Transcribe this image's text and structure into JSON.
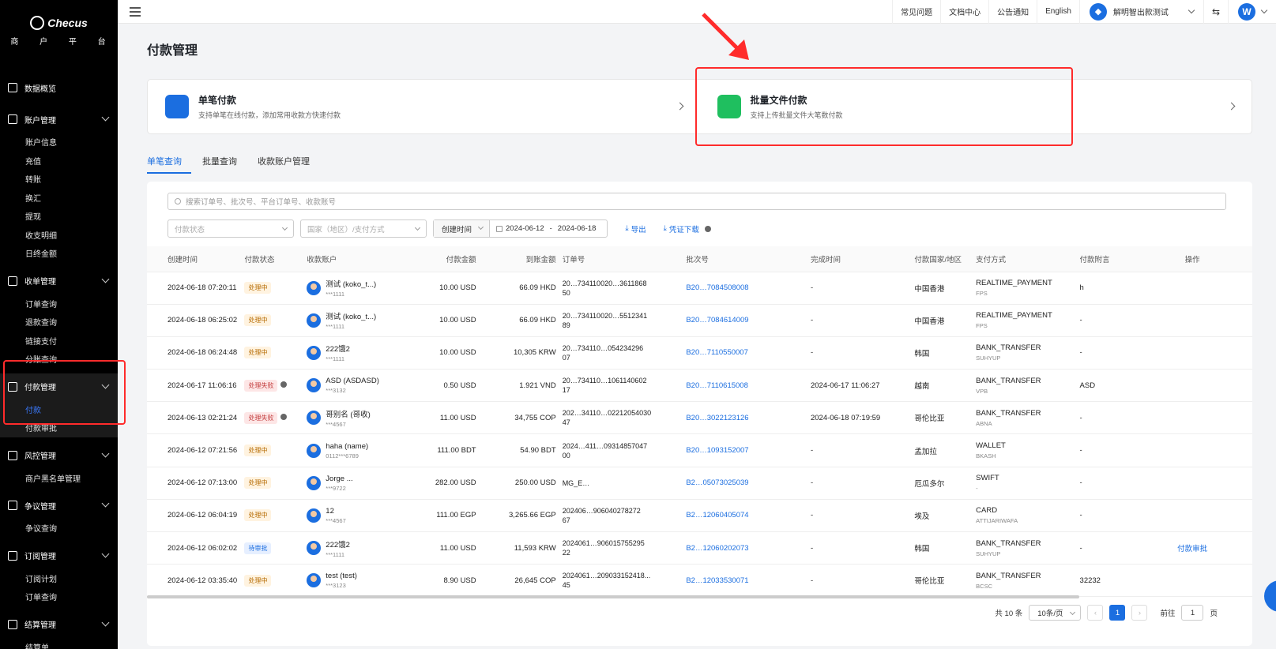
{
  "brand": {
    "name": "Checus",
    "subtitle": "商 户 平 台"
  },
  "sidebar": {
    "groups": [
      {
        "label": "数据概览",
        "icon": "chart-icon",
        "items": []
      },
      {
        "label": "账户管理",
        "icon": "user-icon",
        "items": [
          "账户信息",
          "充值",
          "转账",
          "换汇",
          "提现",
          "收支明细",
          "日终金额"
        ]
      },
      {
        "label": "收单管理",
        "icon": "doc-icon",
        "items": [
          "订单查询",
          "退款查询",
          "链接支付",
          "分账查询"
        ]
      },
      {
        "label": "付款管理",
        "icon": "pay-icon",
        "items": [
          "付款",
          "付款审批"
        ]
      },
      {
        "label": "风控管理",
        "icon": "shield-icon",
        "items": [
          "商户黑名单管理"
        ]
      },
      {
        "label": "争议管理",
        "icon": "dispute-icon",
        "items": [
          "争议查询"
        ]
      },
      {
        "label": "订阅管理",
        "icon": "calendar-icon",
        "items": [
          "订阅计划",
          "订单查询"
        ]
      },
      {
        "label": "结算管理",
        "icon": "settle-icon",
        "items": [
          "结算单"
        ]
      }
    ],
    "active_item": "付款"
  },
  "topbar": {
    "links": [
      "常见问题",
      "文档中心",
      "公告通知",
      "English"
    ],
    "merchant": "解明智出款测试",
    "avatar_letter": "W"
  },
  "page": {
    "title": "付款管理"
  },
  "cards": [
    {
      "title": "单笔付款",
      "desc": "支持单笔在线付款，添加常用收款方快速付款",
      "color": "#1b6ee0"
    },
    {
      "title": "批量文件付款",
      "desc": "支持上传批量文件大笔数付款",
      "color": "#1fbf5f"
    }
  ],
  "tabs": [
    "单笔查询",
    "批量查询",
    "收款账户管理"
  ],
  "filters": {
    "search_placeholder": "搜索订单号、批次号、平台订单号、收款账号",
    "status_placeholder": "付款状态",
    "country_placeholder": "国家（地区）/支付方式",
    "date_type": "创建时间",
    "date_start": "2024-06-12",
    "date_sep": "-",
    "date_end": "2024-06-18",
    "export": "导出",
    "voucher": "凭证下载"
  },
  "table": {
    "headers": [
      "创建时间",
      "付款状态",
      "收款账户",
      "付款金额",
      "到账金额",
      "订单号",
      "批次号",
      "完成时间",
      "付款国家/地区",
      "支付方式",
      "付款附言",
      "操作"
    ],
    "rows": [
      {
        "created": "2024-06-18 07:20:11",
        "status": "处理中",
        "status_type": "proc",
        "acct_name": "测试 (koko_t...)",
        "acct_no": "***1111",
        "amount": "10.00 USD",
        "received": "66.09 HKD",
        "order1": "20…734110020…3611868",
        "order2": "50",
        "batch": "B20…7084508008",
        "finished": "-",
        "country": "中国香港",
        "pm": "REALTIME_PAYMENT",
        "pm_sub": "FPS",
        "remark": "h",
        "op": ""
      },
      {
        "created": "2024-06-18 06:25:02",
        "status": "处理中",
        "status_type": "proc",
        "acct_name": "测试 (koko_t...)",
        "acct_no": "***1111",
        "amount": "10.00 USD",
        "received": "66.09 HKD",
        "order1": "20…734110020…5512341",
        "order2": "89",
        "batch": "B20…7084614009",
        "finished": "-",
        "country": "中国香港",
        "pm": "REALTIME_PAYMENT",
        "pm_sub": "FPS",
        "remark": "-",
        "op": ""
      },
      {
        "created": "2024-06-18 06:24:48",
        "status": "处理中",
        "status_type": "proc",
        "acct_name": "222饿2",
        "acct_no": "***1111",
        "amount": "10.00 USD",
        "received": "10,305 KRW",
        "order1": "20…734110…054234296",
        "order2": "07",
        "batch": "B20…7110550007",
        "finished": "-",
        "country": "韩国",
        "pm": "BANK_TRANSFER",
        "pm_sub": "SUHYUP",
        "remark": "-",
        "op": ""
      },
      {
        "created": "2024-06-17 11:06:16",
        "status": "处理失败",
        "status_type": "fail",
        "acct_name": "ASD (ASDASD)",
        "acct_no": "***3132",
        "amount": "0.50 USD",
        "received": "1.921 VND",
        "order1": "20…734110…1061140602",
        "order2": "17",
        "batch": "B20…7110615008",
        "finished": "2024-06-17 11:06:27",
        "country": "越南",
        "pm": "BANK_TRANSFER",
        "pm_sub": "VPB",
        "remark": "ASD",
        "op": ""
      },
      {
        "created": "2024-06-13 02:21:24",
        "status": "处理失败",
        "status_type": "fail",
        "acct_name": "哥别名 (哥收)",
        "acct_no": "***4567",
        "amount": "11.00 USD",
        "received": "34,755 COP",
        "order1": "202…34110…02212054030",
        "order2": "47",
        "batch": "B20…3022123126",
        "finished": "2024-06-18 07:19:59",
        "country": "哥伦比亚",
        "pm": "BANK_TRANSFER",
        "pm_sub": "ABNA",
        "remark": "-",
        "op": ""
      },
      {
        "created": "2024-06-12 07:21:56",
        "status": "处理中",
        "status_type": "proc",
        "acct_name": "haha (name)",
        "acct_no": "0112***6789",
        "amount": "111.00 BDT",
        "received": "54.90 BDT",
        "order1": "2024…411…09314857047",
        "order2": "00",
        "batch": "B20…1093152007",
        "finished": "-",
        "country": "孟加拉",
        "pm": "WALLET",
        "pm_sub": "BKASH",
        "remark": "-",
        "op": ""
      },
      {
        "created": "2024-06-12 07:13:00",
        "status": "处理中",
        "status_type": "proc",
        "acct_name": "Jorge ...",
        "acct_no": "***9722",
        "amount": "282.00 USD",
        "received": "250.00 USD",
        "order1": "MG_E…",
        "order2": "",
        "batch": "B2…05073025039",
        "finished": "-",
        "country": "厄瓜多尔",
        "pm": "SWIFT",
        "pm_sub": "-",
        "remark": "-",
        "op": ""
      },
      {
        "created": "2024-06-12 06:04:19",
        "status": "处理中",
        "status_type": "proc",
        "acct_name": "12",
        "acct_no": "***4567",
        "amount": "111.00 EGP",
        "received": "3,265.66 EGP",
        "order1": "202406…906040278272",
        "order2": "67",
        "batch": "B2…12060405074",
        "finished": "-",
        "country": "埃及",
        "pm": "CARD",
        "pm_sub": "ATTIJARIWAFA",
        "remark": "-",
        "op": ""
      },
      {
        "created": "2024-06-12 06:02:02",
        "status": "待审批",
        "status_type": "rev",
        "acct_name": "222饿2",
        "acct_no": "***1111",
        "amount": "11.00 USD",
        "received": "11,593 KRW",
        "order1": "2024061…906015755295",
        "order2": "22",
        "batch": "B2…12060202073",
        "finished": "-",
        "country": "韩国",
        "pm": "BANK_TRANSFER",
        "pm_sub": "SUHYUP",
        "remark": "-",
        "op": "付款审批"
      },
      {
        "created": "2024-06-12 03:35:40",
        "status": "处理中",
        "status_type": "proc",
        "acct_name": "test (test)",
        "acct_no": "***3123",
        "amount": "8.90 USD",
        "received": "26,645 COP",
        "order1": "2024061…209033152418...",
        "order2": "45",
        "batch": "B2…12033530071",
        "finished": "-",
        "country": "哥伦比亚",
        "pm": "BANK_TRANSFER",
        "pm_sub": "BCSC",
        "remark": "32232",
        "op": ""
      }
    ]
  },
  "pager": {
    "total": "共 10 条",
    "page_size": "10条/页",
    "current": "1",
    "goto_label": "前往",
    "goto_value": "1",
    "page_unit": "页"
  }
}
